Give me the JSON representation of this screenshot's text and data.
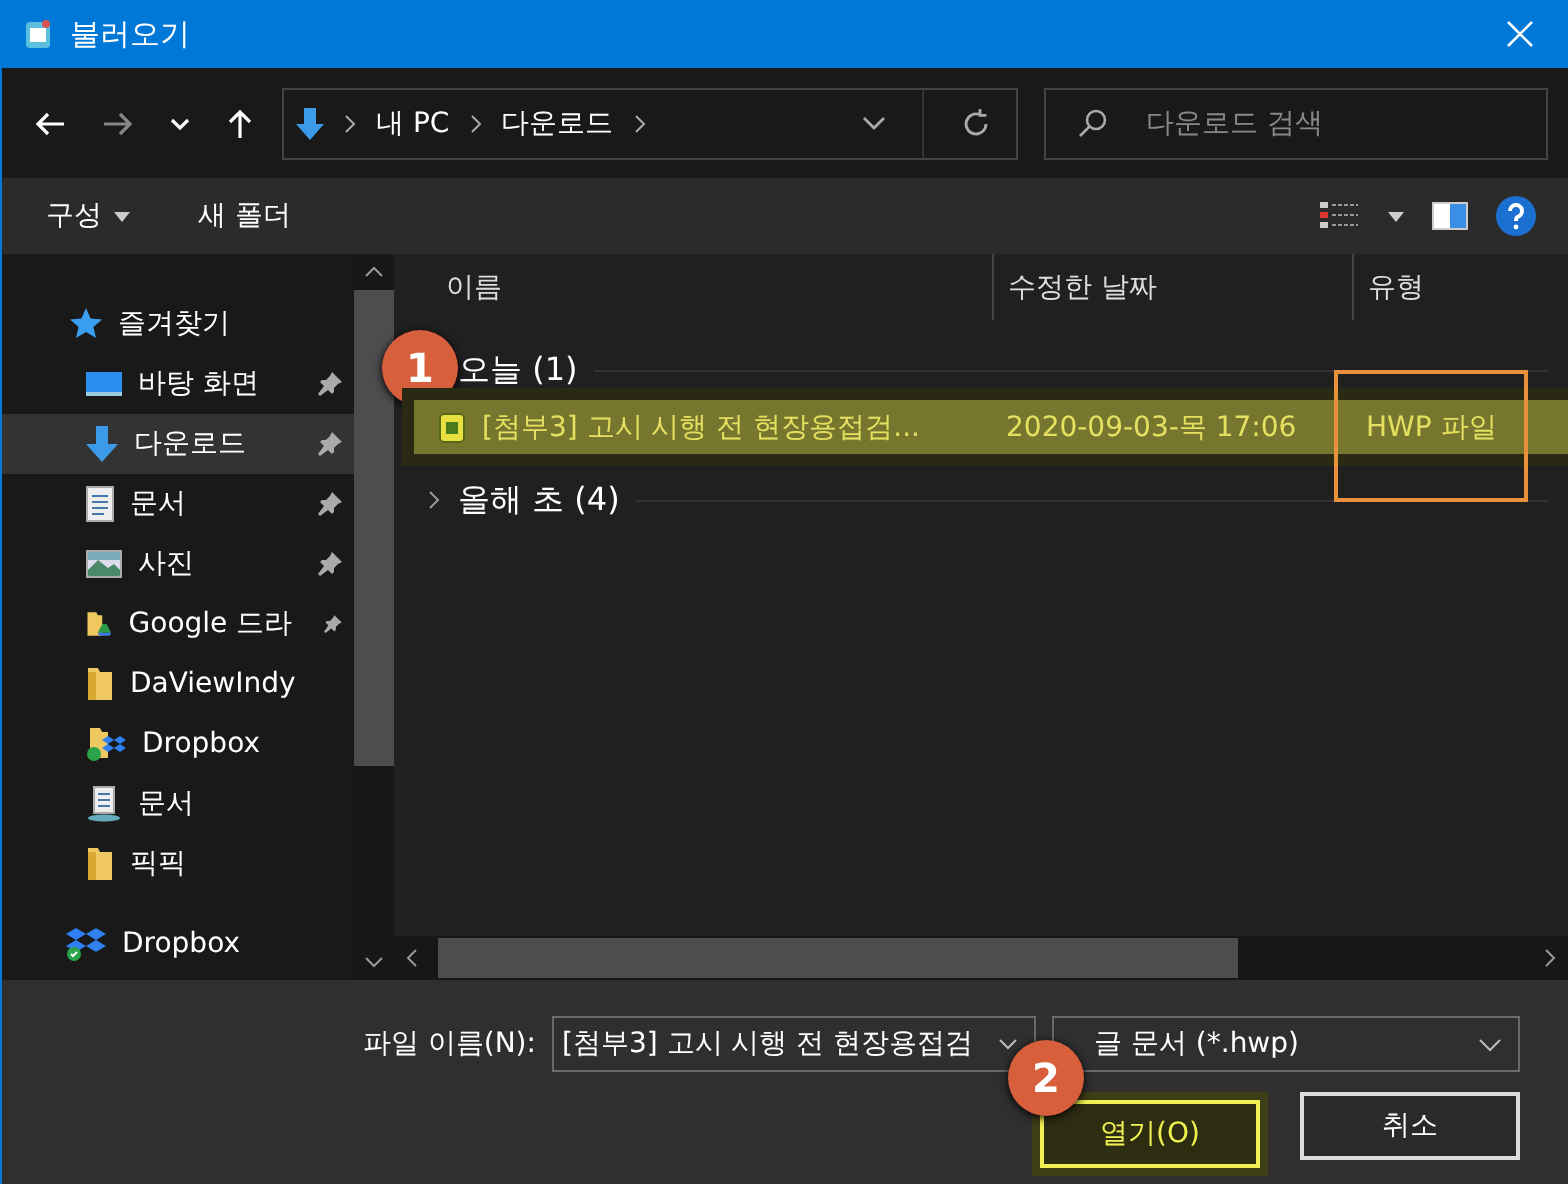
{
  "window": {
    "title": "불러오기"
  },
  "address": {
    "path": [
      "내 PC",
      "다운로드"
    ],
    "search_placeholder": "다운로드 검색"
  },
  "toolbar": {
    "organize": "구성",
    "new_folder": "새 폴더"
  },
  "sidebar": {
    "items": [
      {
        "label": "즐겨찾기",
        "kind": "star",
        "selected": false,
        "children": [
          {
            "label": "바탕 화면",
            "kind": "desktop",
            "pinned": true,
            "selected": false
          },
          {
            "label": "다운로드",
            "kind": "download",
            "pinned": true,
            "selected": true
          },
          {
            "label": "문서",
            "kind": "document",
            "pinned": true,
            "selected": false
          },
          {
            "label": "사진",
            "kind": "pictures",
            "pinned": true,
            "selected": false
          },
          {
            "label": "Google 드라",
            "kind": "drive",
            "pinned": true,
            "selected": false
          },
          {
            "label": "DaViewIndy",
            "kind": "folder",
            "pinned": false,
            "selected": false
          },
          {
            "label": "Dropbox",
            "kind": "dropbox-folder",
            "pinned": false,
            "selected": false
          },
          {
            "label": "문서",
            "kind": "network-doc",
            "pinned": false,
            "selected": false
          },
          {
            "label": "픽픽",
            "kind": "folder",
            "pinned": false,
            "selected": false
          }
        ]
      },
      {
        "label": "Dropbox",
        "kind": "dropbox",
        "selected": false
      }
    ]
  },
  "table": {
    "columns": [
      "이름",
      "수정한 날짜",
      "유형"
    ],
    "groups": [
      {
        "label": "오늘 (1)",
        "expanded": true,
        "rows": [
          {
            "name": "[첨부3] 고시 시행 전 현장용접검...",
            "date": "2020-09-03-목 17:06",
            "type": "HWP 파일",
            "selected": true
          }
        ]
      },
      {
        "label": "올해 초 (4)",
        "expanded": false
      }
    ]
  },
  "footer": {
    "filename_label": "파일 이름(N):",
    "filename": "[첨부3] 고시 시행 전 현장용접검",
    "filter": "글 문서 (*.hwp)",
    "open": "열기(O)",
    "cancel": "취소"
  },
  "annotations": [
    {
      "number": "1"
    },
    {
      "number": "2"
    }
  ]
}
